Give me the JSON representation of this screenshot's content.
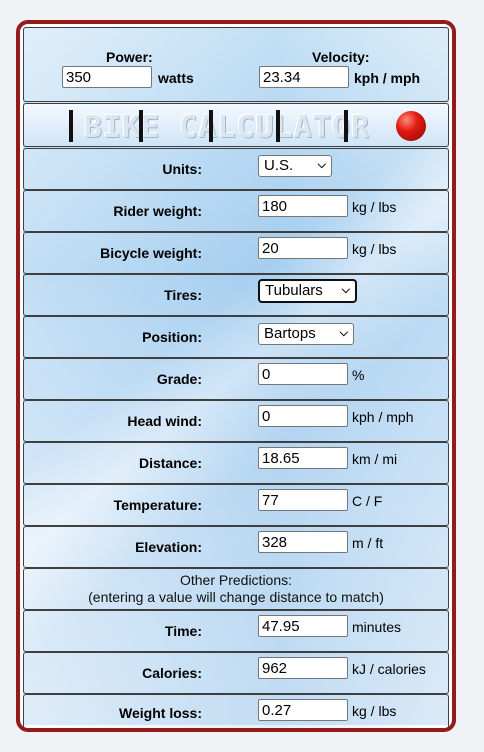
{
  "header": {
    "power_label": "Power:",
    "power_value": "350",
    "power_unit": "watts",
    "velocity_label": "Velocity:",
    "velocity_value": "23.34",
    "velocity_unit": "kph / mph"
  },
  "banner": {
    "text": "BIKE CALCULATOR"
  },
  "units": {
    "label": "Units:",
    "value": "U.S."
  },
  "rider_weight": {
    "label": "Rider weight:",
    "value": "180",
    "unit": "kg / lbs"
  },
  "bicycle_weight": {
    "label": "Bicycle weight:",
    "value": "20",
    "unit": "kg / lbs"
  },
  "tires": {
    "label": "Tires:",
    "value": "Tubulars"
  },
  "position": {
    "label": "Position:",
    "value": "Bartops"
  },
  "grade": {
    "label": "Grade:",
    "value": "0",
    "unit": "%"
  },
  "head_wind": {
    "label": "Head wind:",
    "value": "0",
    "unit": "kph / mph"
  },
  "distance": {
    "label": "Distance:",
    "value": "18.65",
    "unit": "km / mi"
  },
  "temperature": {
    "label": "Temperature:",
    "value": "77",
    "unit": "C / F"
  },
  "elevation": {
    "label": "Elevation:",
    "value": "328",
    "unit": "m / ft"
  },
  "other": {
    "line1": "Other Predictions:",
    "line2": "(entering a value will change distance to match)"
  },
  "time": {
    "label": "Time:",
    "value": "47.95",
    "unit": "minutes"
  },
  "calories": {
    "label": "Calories:",
    "value": "962",
    "unit": "kJ / calories"
  },
  "weight_loss": {
    "label": "Weight loss:",
    "value": "0.27",
    "unit": "kg / lbs"
  },
  "colors": {
    "frame_border": "#951a1a",
    "panel_blue": "#aed3f1"
  }
}
